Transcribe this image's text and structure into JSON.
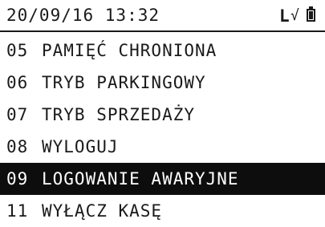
{
  "status_bar": {
    "datetime": "20/09/16 13:32",
    "login_indicator": "L",
    "check_symbol": "√",
    "battery_icon": "battery-icon"
  },
  "menu": {
    "selected_index": 4,
    "items": [
      {
        "number": "05",
        "label": "PAMIĘĆ CHRONIONA"
      },
      {
        "number": "06",
        "label": "TRYB PARKINGOWY"
      },
      {
        "number": "07",
        "label": "TRYB SPRZEDAŻY"
      },
      {
        "number": "08",
        "label": "WYLOGUJ"
      },
      {
        "number": "09",
        "label": "LOGOWANIE AWARYJNE"
      },
      {
        "number": "11",
        "label": "WYŁĄCZ KASĘ"
      }
    ]
  },
  "colors": {
    "foreground": "#1a1a1a",
    "background": "#ffffff",
    "highlight_background": "#0d0d0d",
    "highlight_text": "#ffffff"
  }
}
